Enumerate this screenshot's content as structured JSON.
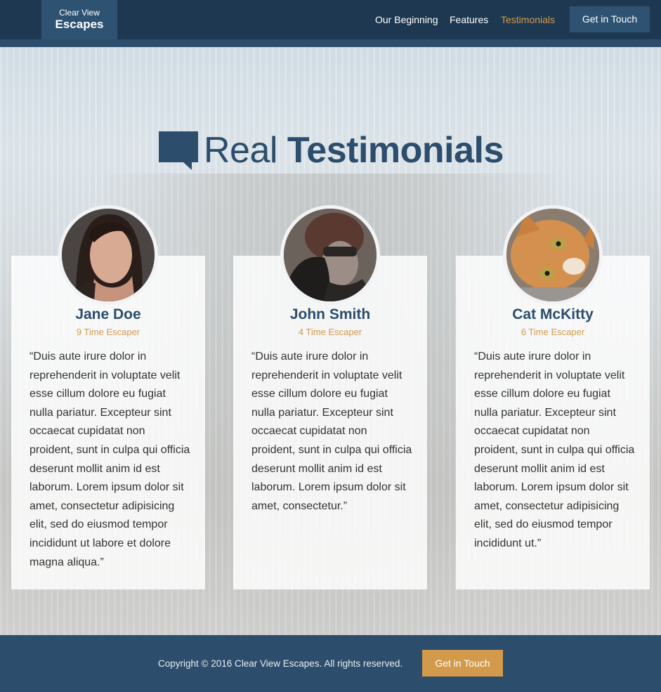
{
  "header": {
    "logo_line1": "Clear View",
    "logo_line2": "Escapes",
    "nav": [
      "Our Beginning",
      "Features",
      "Testimonials"
    ],
    "active_nav": "Testimonials",
    "cta": "Get in Touch"
  },
  "section": {
    "title_light": "Real",
    "title_bold": "Testimonials",
    "icon": "speech-bubble-icon"
  },
  "testimonials": [
    {
      "name": "Jane Doe",
      "subtitle": "9 Time Escaper",
      "quote": "“Duis aute irure dolor in reprehenderit in voluptate velit esse cillum dolore eu fugiat nulla pariatur. Excepteur sint occaecat cupidatat non proident, sunt in culpa qui officia deserunt mollit anim id est laborum. Lorem ipsum dolor sit amet, consectetur adipisicing elit, sed do eiusmod tempor incididunt ut labore et dolore magna aliqua.”"
    },
    {
      "name": "John Smith",
      "subtitle": "4 Time Escaper",
      "quote": "“Duis aute irure dolor in reprehenderit in voluptate velit esse cillum dolore eu fugiat nulla pariatur. Excepteur sint occaecat cupidatat non proident, sunt in culpa qui officia deserunt mollit anim id est laborum. Lorem ipsum dolor sit amet, consectetur.”"
    },
    {
      "name": "Cat McKitty",
      "subtitle": "6 Time Escaper",
      "quote": "“Duis aute irure dolor in reprehenderit in voluptate velit esse cillum dolore eu fugiat nulla pariatur. Excepteur sint occaecat cupidatat non proident, sunt in culpa qui officia deserunt mollit anim id est laborum. Lorem ipsum dolor sit amet, consectetur adipisicing elit, sed do eiusmod tempor incididunt ut.”"
    }
  ],
  "footer": {
    "copyright": "Copyright © 2016 Clear View Escapes. All rights reserved.",
    "cta": "Get in Touch"
  },
  "colors": {
    "navy": "#1e3851",
    "brand_blue": "#2c4d6b",
    "accent_gold": "#d39a4c"
  }
}
